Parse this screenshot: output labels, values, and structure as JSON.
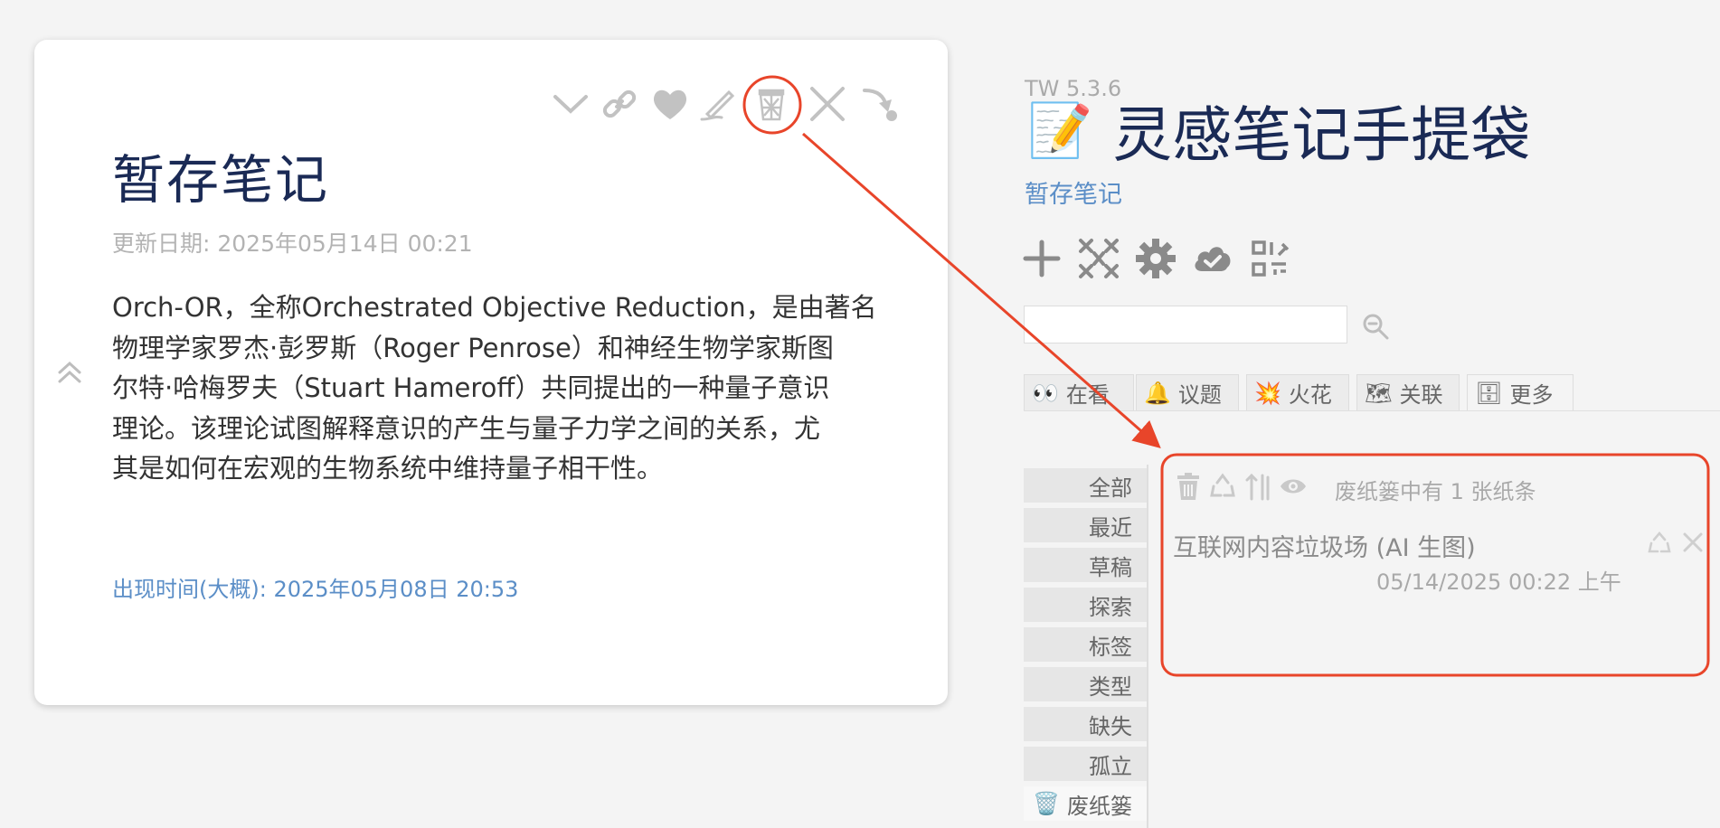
{
  "tiddler": {
    "title": "暂存笔记",
    "modified": "更新日期: 2025年05月14日 00:21",
    "body_lines": [
      "Orch-OR，全称Orchestrated Objective Reduction，是由著名",
      "物理学家罗杰·彭罗斯（Roger Penrose）和神经生物学家斯图",
      "尔特·哈梅罗夫（Stuart Hameroff）共同提出的一种量子意识",
      "理论。该理论试图解释意识的产生与量子力学之间的关系，尤",
      "其是如何在宏观的生物系统中维持量子相干性。"
    ],
    "appeared": "出现时间(大概): 2025年05月08日 20:53",
    "toolbar_icons": [
      "chevron-down-icon",
      "link-icon",
      "heart-icon",
      "edit-icon",
      "trash-can-icon",
      "close-icon",
      "sink-icon"
    ]
  },
  "sidebar": {
    "version": "TW 5.3.6",
    "title_emoji": "📝",
    "title": "灵感笔记手提袋",
    "subtitle": "暂存笔记",
    "buttons": [
      "plus-icon",
      "close-all-icon",
      "gear-icon",
      "cloud-icon",
      "qr-code-icon"
    ],
    "search": {
      "value": "",
      "placeholder": ""
    },
    "tabs": [
      {
        "emoji": "👀",
        "label": "在看"
      },
      {
        "emoji": "🔔",
        "label": "议题"
      },
      {
        "emoji": "💥",
        "label": "火花"
      },
      {
        "emoji": "🗺",
        "label": "关联"
      },
      {
        "emoji": "🗄",
        "label": "更多"
      }
    ],
    "more_tabs": [
      "全部",
      "最近",
      "草稿",
      "探索",
      "标签",
      "类型",
      "缺失",
      "孤立",
      "废纸篓"
    ],
    "recycle_bin": {
      "tab_emoji": "🗑️",
      "count_text": "废纸篓中有 1 张纸条",
      "items": [
        {
          "title": "互联网内容垃圾场 (AI 生图)",
          "date": "05/14/2025 00:22 上午"
        }
      ]
    }
  },
  "colors": {
    "title": "#1a2a55",
    "link": "#5b8ec7",
    "annotation": "#e8452a"
  }
}
